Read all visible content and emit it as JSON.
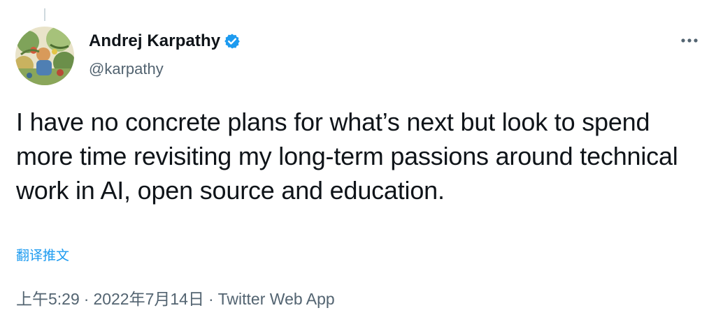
{
  "author": {
    "display_name": "Andrej Karpathy",
    "handle": "@karpathy",
    "verified": true
  },
  "tweet": {
    "text": "I have no concrete plans for what’s next but look to spend more time revisiting my long-term passions around technical work in AI, open source and education.",
    "translate_label": "翻译推文",
    "time": "上午5:29",
    "date": "2022年7月14日",
    "source": "Twitter Web App",
    "separator": "·"
  },
  "icons": {
    "verified": "verified-badge-icon",
    "more": "more-options-icon"
  },
  "colors": {
    "accent": "#1d9bf0",
    "text_primary": "#0f1419",
    "text_secondary": "#536471"
  }
}
